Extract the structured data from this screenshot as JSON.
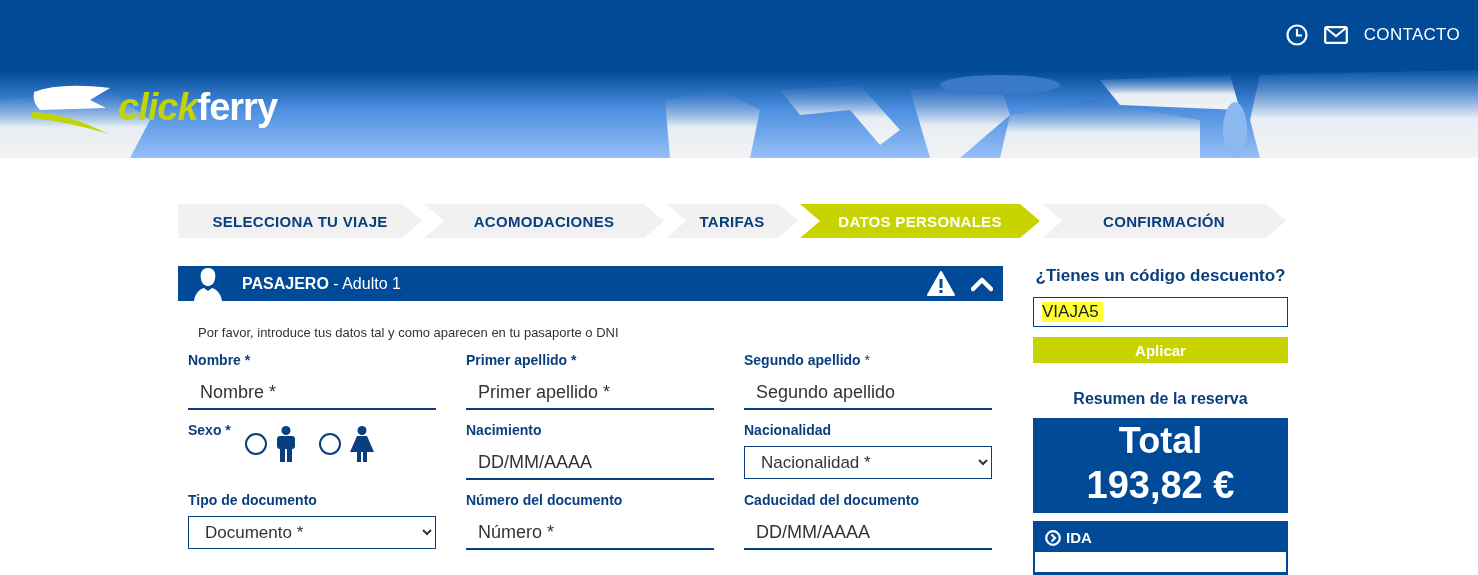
{
  "header": {
    "contact_label": "CONTACTO",
    "logo": {
      "part_1": "click",
      "part_2": "ferry"
    }
  },
  "steps": [
    {
      "label": "SELECCIONA TU VIAJE",
      "selected": false
    },
    {
      "label": "ACOMODACIONES",
      "selected": false
    },
    {
      "label": "TARIFAS",
      "selected": false
    },
    {
      "label": "DATOS PERSONALES",
      "selected": true
    },
    {
      "label": "CONFIRMACIÓN",
      "selected": false
    }
  ],
  "passenger": {
    "title": "**PASAJERO** - Adulto 1",
    "warning": true,
    "expanded": true,
    "intro": "Por favor, introduce tus datos tal y como aparecen en tu pasaporte o DNI",
    "fields": [
      {
        "kind": "text",
        "label": "Nombre *",
        "placeholder": "Nombre *"
      },
      {
        "kind": "text",
        "label": "Primer apellido *",
        "placeholder": "Primer apellido *"
      },
      {
        "kind": "text",
        "label": "**Segundo apellido** *",
        "placeholder": "Segundo apellido",
        "plain_weight": true
      },
      {
        "kind": "radio",
        "label": "Sexo *",
        "options": [
          {
            "kind": "male",
            "selected": false
          },
          {
            "kind": "female",
            "selected": false
          }
        ]
      },
      {
        "kind": "text",
        "label": "Nacimiento",
        "placeholder": "DD/MM/AAAA"
      },
      {
        "kind": "select",
        "label": "Nacionalidad",
        "value": "Nacionalidad *"
      },
      {
        "kind": "select",
        "label": "Tipo de documento",
        "value": "Documento *"
      },
      {
        "kind": "text",
        "label": "Número del documento",
        "placeholder": "Número *"
      },
      {
        "kind": "text",
        "label": "Caducidad del documento",
        "placeholder": "DD/MM/AAAA"
      }
    ]
  },
  "sidebar": {
    "discount_title": "¿Tienes un código descuento?",
    "discount_code": "VIAJA5",
    "code_highlighted": true,
    "apply_button": "Aplicar",
    "summary_title": "Resumen de la reserva",
    "total_label": "Total",
    "total_value": "193,82 €",
    "leg_title": "IDA"
  }
}
